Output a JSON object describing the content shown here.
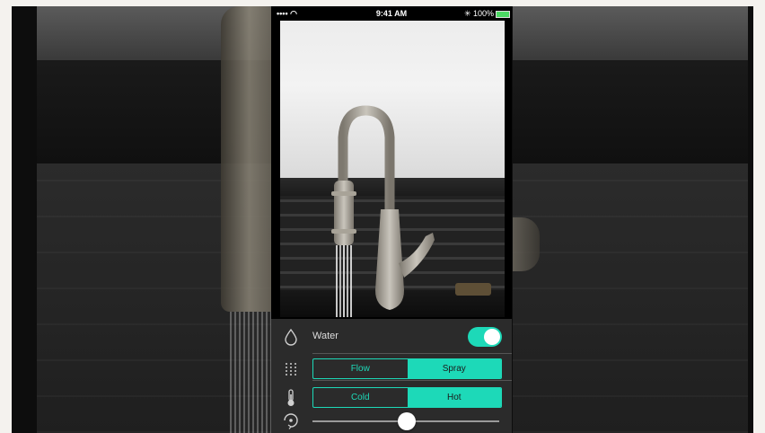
{
  "status_bar": {
    "signal": "•••• ◠",
    "time": "9:41 AM",
    "battery_text": "✳ 100%"
  },
  "controls": {
    "water": {
      "label": "Water",
      "icon": "water-drop-icon",
      "enabled": true
    },
    "mode": {
      "icon": "spray-dots-icon",
      "options": [
        "Flow",
        "Spray"
      ],
      "selected": "Spray"
    },
    "temperature": {
      "icon": "thermometer-icon",
      "options": [
        "Cold",
        "Hot"
      ],
      "selected": "Hot"
    },
    "rotation": {
      "icon": "rotate-icon",
      "slider_fraction": 0.5
    }
  },
  "colors": {
    "accent": "#1dd9b8",
    "panel": "#2b2b2b"
  }
}
